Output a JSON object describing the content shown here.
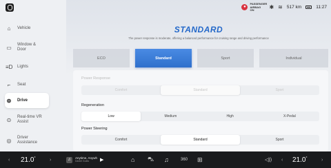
{
  "status": {
    "airbag_line1": "PASSENGER",
    "airbag_line2": "AIRBAG ON",
    "bluetooth_icon": "bluetooth-icon",
    "wifi_icon": "wifi-icon",
    "range": "517 km",
    "time": "11:27"
  },
  "sidebar": {
    "items": [
      {
        "label": "Vehicle",
        "icon": "car-icon"
      },
      {
        "label": "Window & Door",
        "icon": "window-icon"
      },
      {
        "label": "Lights",
        "icon": "lights-icon"
      },
      {
        "label": "Seat",
        "icon": "seat-icon"
      },
      {
        "label": "Drive",
        "icon": "steering-wheel-icon",
        "active": true
      },
      {
        "label": "Real-time VR Assist",
        "icon": "vr-assist-icon"
      },
      {
        "label": "Driver Assistance",
        "icon": "driver-assist-icon"
      }
    ]
  },
  "drive": {
    "mode_title": "STANDARD",
    "mode_description": "The power response is moderate, offering a balanced performance for cruising range and driving performance",
    "modes": [
      "ECO",
      "Standard",
      "Sport",
      "Individual"
    ],
    "selected_mode": "Standard",
    "power_response": {
      "title": "Power Response",
      "options": [
        "Comfort",
        "Standard",
        "Sport"
      ],
      "selected": "Standard",
      "disabled": true
    },
    "regeneration": {
      "title": "Regeneration",
      "options": [
        "Low",
        "Medium",
        "High",
        "X-Pedal"
      ],
      "selected": "Low"
    },
    "power_steering": {
      "title": "Power Steering",
      "options": [
        "Comfort",
        "Standard",
        "Sport"
      ],
      "selected": "Standard"
    }
  },
  "bottom": {
    "left_temp": "21.0",
    "right_temp": "21.0",
    "degree": "°",
    "song_title": "Anytime, Anywh",
    "song_artist": "Daniel Guelo",
    "dock_icons": [
      "home-icon",
      "car-icon",
      "music-icon",
      "360-camera-icon",
      "apps-grid-icon",
      "volume-icon"
    ]
  },
  "colors": {
    "accent": "#2f70cc",
    "airbag": "#d9323f",
    "dock": "#1a1b1d"
  }
}
